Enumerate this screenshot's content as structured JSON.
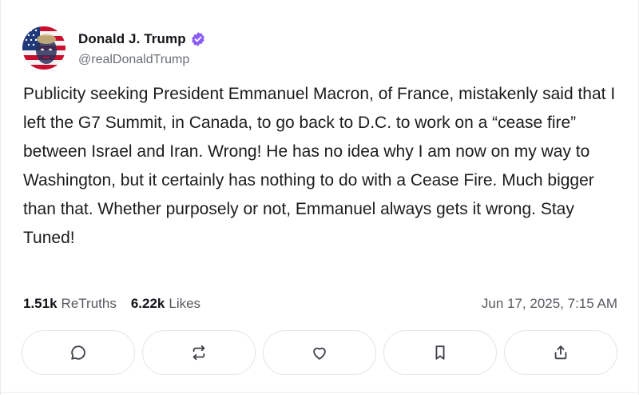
{
  "author": {
    "display_name": "Donald J. Trump",
    "handle": "@realDonaldTrump",
    "verified": true,
    "verified_color": "#8b5cf6"
  },
  "post": {
    "text": "Publicity seeking President Emmanuel Macron, of France, mistakenly said that I left the G7 Summit, in Canada, to go back to D.C. to work on a “cease fire” between Israel and Iran. Wrong! He has no idea why I am now on my way to Washington, but it certainly has nothing to do with a Cease Fire. Much bigger than that. Whether purposely or not, Emmanuel always gets it wrong. Stay Tuned!"
  },
  "stats": {
    "retruths_count": "1.51k",
    "retruths_label": "ReTruths",
    "likes_count": "6.22k",
    "likes_label": "Likes",
    "timestamp": "Jun 17, 2025, 7:15 AM"
  },
  "actions": [
    {
      "icon": "reply-icon"
    },
    {
      "icon": "retruth-icon"
    },
    {
      "icon": "like-icon"
    },
    {
      "icon": "bookmark-icon"
    },
    {
      "icon": "share-icon"
    }
  ],
  "colors": {
    "text": "#1c1c1e",
    "muted": "#55595f",
    "border": "#e4e4e8",
    "icon": "#3d4148"
  }
}
